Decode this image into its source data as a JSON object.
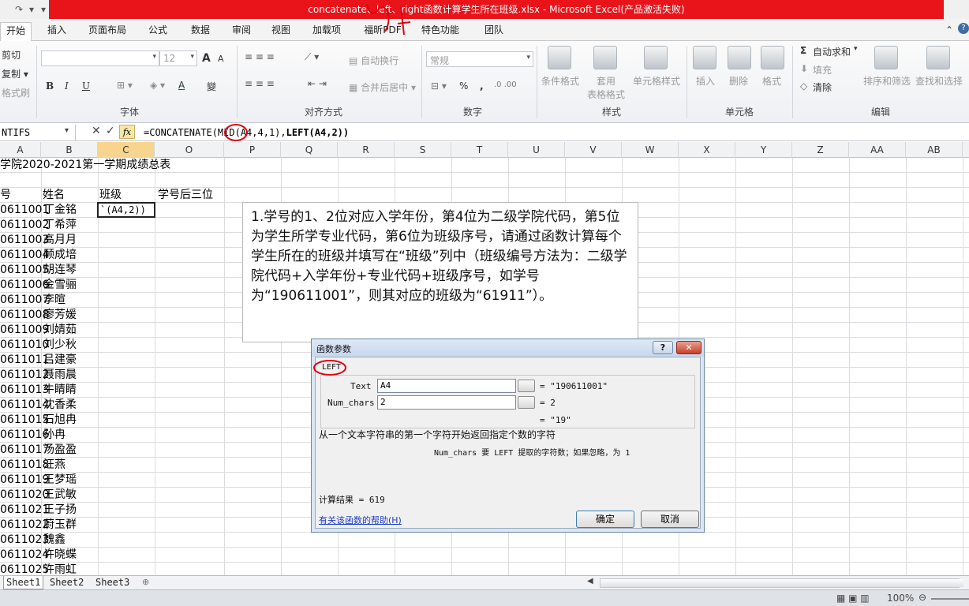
{
  "title": "concatenate、left、right函数计算学生所在班级.xlsx - Microsoft Excel(产品激活失败)",
  "tabs": [
    "开始",
    "插入",
    "页面布局",
    "公式",
    "数据",
    "审阅",
    "视图",
    "加载项",
    "福昕PDF",
    "特色功能",
    "团队"
  ],
  "ribbon": {
    "clipboard": {
      "cut": "剪切",
      "copy": "复制 ▾",
      "format_painter": "格式刷"
    },
    "font": {
      "size": "12",
      "label": "字体",
      "bold": "B",
      "italic": "I",
      "underline": "U",
      "grow": "A",
      "shrink": "A",
      "font_color": "A",
      "wen": "變"
    },
    "alignment": {
      "wrap": "自动换行",
      "merge": "合并后居中",
      "label": "对齐方式"
    },
    "number": {
      "format": "常规",
      "label": "数字",
      "percent": "%",
      "comma": ","
    },
    "styles": {
      "conditional": "条件格式",
      "table": "套用\n表格格式",
      "cell_styles": "单元格样式",
      "label": "样式"
    },
    "cells": {
      "insert": "插入",
      "delete": "删除",
      "format": "格式",
      "label": "单元格"
    },
    "editing": {
      "autosum": "自动求和",
      "fill": "填充",
      "clear": "清除",
      "sort": "排序和筛选",
      "find": "查找和选择",
      "label": "编辑"
    }
  },
  "formula_bar": {
    "name_box": "NTIFS",
    "fx": "fx",
    "formula_prefix": "=CONCATENATE(",
    "formula_mid": "MID",
    "formula_rest": "(A4,4,1),",
    "formula_left": "LEFT(A4,2))"
  },
  "columns": [
    "A",
    "B",
    "C",
    "O",
    "P",
    "Q",
    "R",
    "S",
    "T",
    "U",
    "V",
    "W",
    "X",
    "Y",
    "Z",
    "AA",
    "AB"
  ],
  "sheet": {
    "title_row": "学院2020-2021第一学期成绩总表",
    "header": {
      "col_a": "号",
      "name": "姓名",
      "class": "班级",
      "last3": "学号后三位"
    },
    "editing_cell": "`(A4,2))",
    "ids": [
      "0611001",
      "0611002",
      "0611003",
      "0611004",
      "0611005",
      "0611006",
      "0611007",
      "0611008",
      "0611009",
      "0611010",
      "0611011",
      "0611012",
      "0611013",
      "0611014",
      "0611015",
      "0611016",
      "0611017",
      "0611018",
      "0611019",
      "0611020",
      "0611021",
      "0611022",
      "0611023",
      "0611024",
      "0611025"
    ],
    "names": [
      "丁金铭",
      "丁希萍",
      "高月月",
      "顾成培",
      "胡连琴",
      "金雪骊",
      "李暄",
      "廖芳媛",
      "刘婧茹",
      "刘少秋",
      "吕建豪",
      "聂雨晨",
      "牛睛睛",
      "沈香柔",
      "石旭冉",
      "孙冉",
      "汤盈盈",
      "汪燕",
      "王梦瑶",
      "王武敏",
      "王子扬",
      "蔚玉群",
      "魏鑫",
      "许晓蝶",
      "许雨虹"
    ]
  },
  "note": "1.学号的1、2位对应入学年份，第4位为二级学院代码，第5位为学生所学专业代码，第6位为班级序号，请通过函数计算每个学生所在的班级并填写在“班级”列中（班级编号方法为：二级学院代码+入学年份+专业代码+班级序号，如学号为“190611001”，则其对应的班级为“61911”）。",
  "dialog": {
    "title": "函数参数",
    "func": "LEFT",
    "text_label": "Text",
    "text_value": "A4",
    "text_result": "= \"190611001\"",
    "numchars_label": "Num_chars",
    "numchars_value": "2",
    "numchars_result": "= 2",
    "result_preview": "= \"19\"",
    "description": "从一个文本字符串的第一个字符开始返回指定个数的字符",
    "param_help": "Num_chars  要 LEFT 提取的字符数；如果忽略，为 1",
    "calc_result": "计算结果 = 619",
    "help_link": "有关该函数的帮助(H)",
    "ok": "确定",
    "cancel": "取消",
    "help_btn": "?",
    "close_btn": "✕"
  },
  "sheets": [
    "Sheet1",
    "Sheet2",
    "Sheet3"
  ],
  "status": {
    "zoom": "100%"
  },
  "colors": {
    "title_red": "#e8141a",
    "annotation_red": "#e00010",
    "link_blue": "#1a3cc8"
  }
}
